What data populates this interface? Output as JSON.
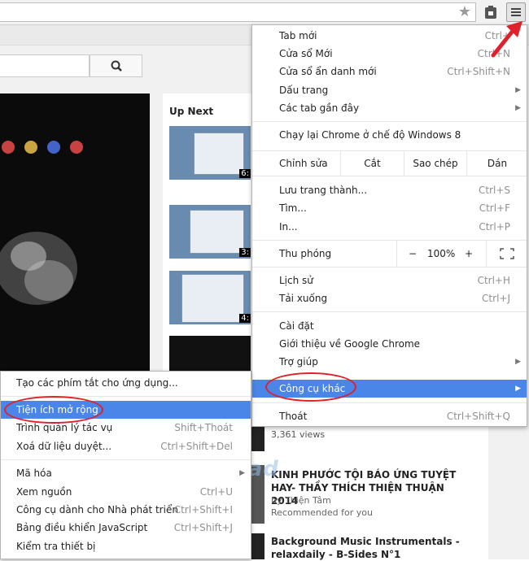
{
  "toolbar": {
    "star": "star-icon",
    "extension": "extension-icon",
    "menu": "hamburger-menu-icon"
  },
  "page": {
    "up_next": "Up Next",
    "durations": [
      "6:",
      "3:",
      "4:"
    ],
    "views": "3,361 views",
    "watermark": "Download",
    "result1": {
      "title": "KINH PHƯỚC TỘI BÁO ỨNG TUYỆT HAY- THẦY THÍCH THIỆN THUẬN 2014",
      "author": "by Thiện Tâm",
      "note": "Recommended for you"
    },
    "result2": {
      "title": "Background Music Instrumentals - relaxdaily - B-Sides N°1"
    }
  },
  "menu": {
    "new_tab": {
      "label": "Tab mới",
      "shortcut": "Ctrl+"
    },
    "new_window": {
      "label": "Cửa sổ Mới",
      "shortcut": "Ctrl+N"
    },
    "incognito": {
      "label": "Cửa sổ ẩn danh mới",
      "shortcut": "Ctrl+Shift+N"
    },
    "bookmarks": {
      "label": "Dấu trang"
    },
    "recent_tabs": {
      "label": "Các tab gần đây"
    },
    "relaunch": {
      "label": "Chạy lại Chrome ở chế độ Windows 8"
    },
    "edit": {
      "label": "Chỉnh sửa",
      "cut": "Cắt",
      "copy": "Sao chép",
      "paste": "Dán"
    },
    "save": {
      "label": "Lưu trang thành...",
      "shortcut": "Ctrl+S"
    },
    "find": {
      "label": "Tìm...",
      "shortcut": "Ctrl+F"
    },
    "print": {
      "label": "In...",
      "shortcut": "Ctrl+P"
    },
    "zoom": {
      "label": "Thu phóng",
      "minus": "−",
      "value": "100%",
      "plus": "+"
    },
    "history": {
      "label": "Lịch sử",
      "shortcut": "Ctrl+H"
    },
    "downloads": {
      "label": "Tải xuống",
      "shortcut": "Ctrl+J"
    },
    "settings": {
      "label": "Cài đặt"
    },
    "about": {
      "label": "Giới thiệu về Google Chrome"
    },
    "help": {
      "label": "Trợ giúp"
    },
    "more_tools": {
      "label": "Công cụ khác"
    },
    "exit": {
      "label": "Thoát",
      "shortcut": "Ctrl+Shift+Q"
    }
  },
  "submenu": {
    "shortcuts": {
      "label": "Tạo các phím tắt cho ứng dụng..."
    },
    "extensions": {
      "label": "Tiện ích mở rộng"
    },
    "task_manager": {
      "label": "Trình quản lý tác vụ",
      "shortcut": "Shift+Thoát"
    },
    "clear_data": {
      "label": "Xoá dữ liệu duyệt...",
      "shortcut": "Ctrl+Shift+Del"
    },
    "encoding": {
      "label": "Mã hóa"
    },
    "view_source": {
      "label": "Xem nguồn",
      "shortcut": "Ctrl+U"
    },
    "dev_tools": {
      "label": "Công cụ dành cho Nhà phát triển",
      "shortcut": "Ctrl+Shift+I"
    },
    "js_console": {
      "label": "Bảng điều khiển JavaScript",
      "shortcut": "Ctrl+Shift+J"
    },
    "inspect": {
      "label": "Kiểm tra thiết bị"
    }
  },
  "colors": {
    "highlight": "#4a85e8",
    "annotation": "#e0202a"
  }
}
